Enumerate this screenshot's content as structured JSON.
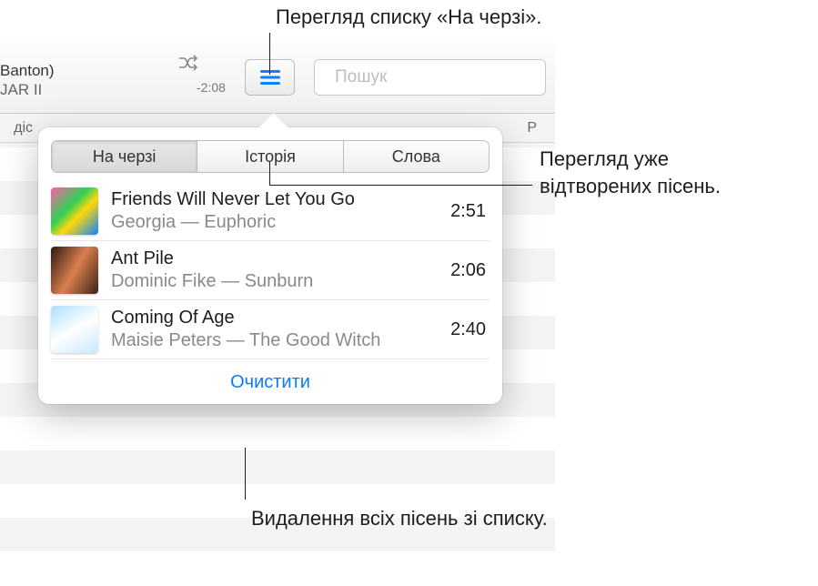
{
  "toolbar": {
    "now_playing_line1": "Banton)",
    "now_playing_line2": "JAR II",
    "time_remaining": "-2:08",
    "search_placeholder": "Пошук"
  },
  "subheader": {
    "left_label": "діс",
    "right_label": "Р"
  },
  "popover": {
    "tabs": {
      "up_next": "На черзі",
      "history": "Історія",
      "lyrics": "Слова"
    },
    "songs": [
      {
        "title": "Friends Will Never Let You Go",
        "artist_line": "Georgia — Euphoric",
        "duration": "2:51"
      },
      {
        "title": "Ant Pile",
        "artist_line": "Dominic Fike — Sunburn",
        "duration": "2:06"
      },
      {
        "title": "Coming Of Age",
        "artist_line": "Maisie Peters — The Good Witch",
        "duration": "2:40"
      }
    ],
    "clear_label": "Очистити"
  },
  "callouts": {
    "view_queue": "Перегляд списку «На черзі».",
    "view_history_l1": "Перегляд уже",
    "view_history_l2": "відтворених пісень.",
    "clear_all": "Видалення всіх пісень зі списку."
  }
}
